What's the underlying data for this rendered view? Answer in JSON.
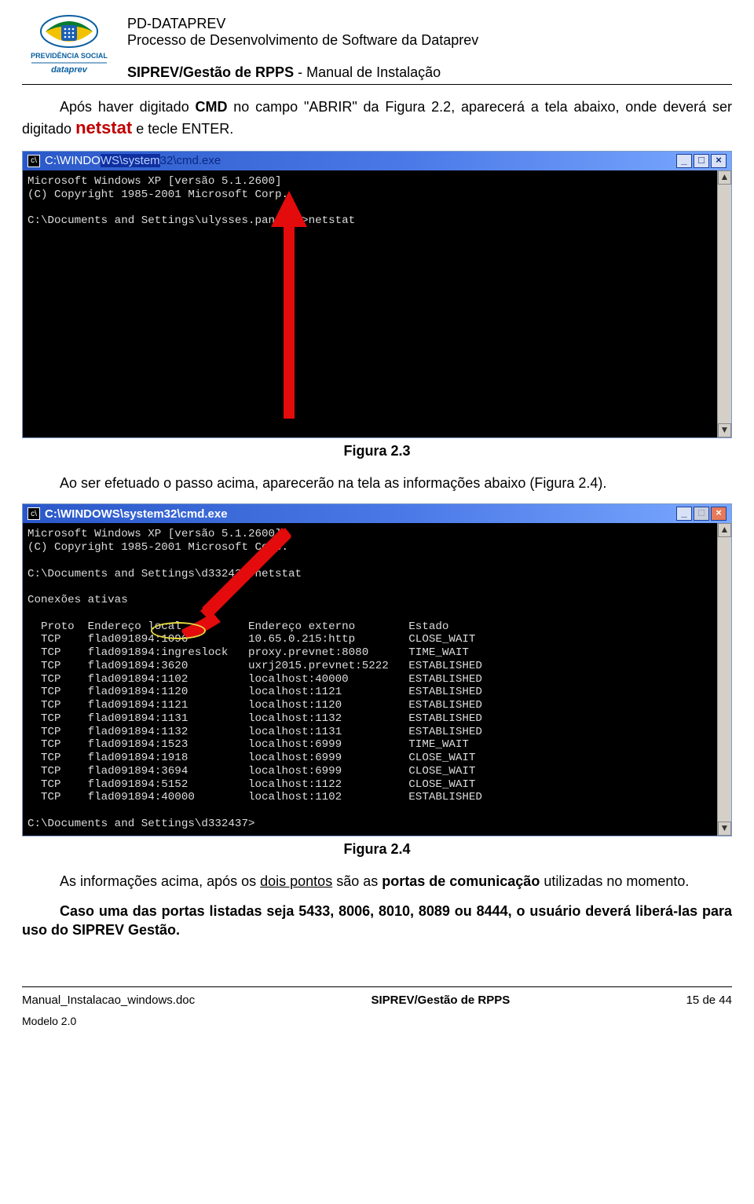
{
  "header": {
    "line1": "PD-DATAPREV",
    "line2": "Processo de Desenvolvimento de Software da Dataprev",
    "line3_bold": "SIPREV/Gestão de RPPS",
    "line3_rest": " - Manual de Instalação",
    "logo_alt_top": "PREVIDÊNCIA SOCIAL",
    "logo_alt_bottom": "dataprev"
  },
  "para1_a": "Após haver digitado ",
  "para1_b": "CMD",
  "para1_c": " no campo \"ABRIR\" da Figura 2.2, aparecerá a tela abaixo, onde deverá ser digitado ",
  "para1_netstat": "netstat",
  "para1_d": " e tecle ENTER.",
  "terminal1": {
    "title_left": "C:\\WINDO",
    "title_mid": "WS\\system",
    "title_right": "32\\cmd.exe",
    "lines": [
      "Microsoft Windows XP [versão 5.1.2600]",
      "(C) Copyright 1985-2001 Microsoft Corp.",
      "",
      "C:\\Documents and Settings\\ulysses.pantoja>netstat"
    ]
  },
  "fig23": "Figura 2.3",
  "para2": "Ao ser efetuado o passo acima, aparecerão na tela as informações abaixo (Figura 2.4).",
  "terminal2": {
    "title": "C:\\WINDOWS\\system32\\cmd.exe",
    "header_lines": [
      "Microsoft Windows XP [versão 5.1.2600]",
      "(C) Copyright 1985-2001 Microsoft Corp.",
      "",
      "C:\\Documents and Settings\\d332437>netstat",
      "",
      "Conexões ativas",
      ""
    ],
    "table_header": "  Proto  Endereço local          Endereço externo        Estado",
    "rows": [
      "  TCP    flad091894:1096         10.65.0.215:http        CLOSE_WAIT",
      "  TCP    flad091894:ingreslock   proxy.prevnet:8080      TIME_WAIT",
      "  TCP    flad091894:3620         uxrj2015.prevnet:5222   ESTABLISHED",
      "  TCP    flad091894:1102         localhost:40000         ESTABLISHED",
      "  TCP    flad091894:1120         localhost:1121          ESTABLISHED",
      "  TCP    flad091894:1121         localhost:1120          ESTABLISHED",
      "  TCP    flad091894:1131         localhost:1132          ESTABLISHED",
      "  TCP    flad091894:1132         localhost:1131          ESTABLISHED",
      "  TCP    flad091894:1523         localhost:6999          TIME_WAIT",
      "  TCP    flad091894:1918         localhost:6999          CLOSE_WAIT",
      "  TCP    flad091894:3694         localhost:6999          CLOSE_WAIT",
      "  TCP    flad091894:5152         localhost:1122          CLOSE_WAIT",
      "  TCP    flad091894:40000        localhost:1102          ESTABLISHED"
    ],
    "prompt_end": "C:\\Documents and Settings\\d332437>"
  },
  "fig24": "Figura 2.4",
  "para3_a": "As informações acima, após os ",
  "para3_under": "dois pontos",
  "para3_b": " são as ",
  "para3_bold1": "portas de comunicação",
  "para3_c": " utilizadas no momento.",
  "para4_a": "Caso uma das portas listadas seja 5433, 8006, 8010, 8089 ou 8444, o usuário deverá liberá-las para uso do SIPREV Gestão.",
  "footer": {
    "left": "Manual_Instalacao_windows.doc",
    "mid": "SIPREV/Gestão de RPPS",
    "right": "15 de 44",
    "modelo": "Modelo 2.0"
  }
}
